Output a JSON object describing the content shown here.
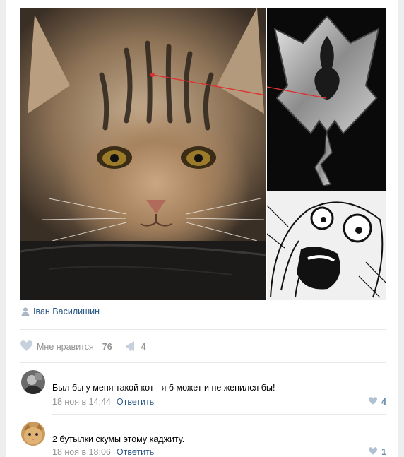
{
  "post": {
    "author": {
      "name": "Іван Василишин"
    },
    "likes": {
      "label": "Мне нравится",
      "count": "76"
    },
    "reposts": {
      "count": "4"
    }
  },
  "comments": [
    {
      "text": "Был бы у меня такой кот - я б может и не женился бы!",
      "date": "18 ноя в 14:44",
      "reply_label": "Ответить",
      "likes": "4"
    },
    {
      "text": "2 бутылки скумы этому каджиту.",
      "date": "18 ноя в 18:06",
      "reply_label": "Ответить",
      "likes": "1"
    }
  ],
  "icons": {
    "author": "person-icon",
    "like": "heart-icon",
    "repost": "megaphone-icon"
  },
  "colors": {
    "link": "#2a5885",
    "muted": "#939393",
    "like_active": "#6b89ab",
    "background": "#edeef0"
  }
}
